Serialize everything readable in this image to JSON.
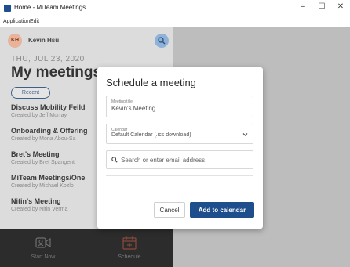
{
  "window": {
    "title": "Home - MiTeam Meetings",
    "minimize_glyph": "–",
    "maximize_glyph": "☐",
    "close_glyph": "✕"
  },
  "menubar": {
    "items": [
      "Application",
      "Edit"
    ]
  },
  "sidebar": {
    "user": {
      "initials": "KH",
      "name": "Kevin Hsu"
    },
    "date": "THU, JUL 23, 2020",
    "title": "My meetings",
    "filter": "Recent",
    "meetings": [
      {
        "title": "Discuss Mobility Feild",
        "creator": "Created by Jeff Murray"
      },
      {
        "title": "Onboarding & Offering",
        "creator": "Created by Mona Abou-Sa"
      },
      {
        "title": "Bret's Meeting",
        "creator": "Created by Bret Spangent"
      },
      {
        "title": "MiTeam Meetings/One",
        "creator": "Created by Michael Kozlo"
      },
      {
        "title": "Nitin's Meeting",
        "creator": "Created by Nitin Verma"
      }
    ],
    "bottom": {
      "start_label": "Start Now",
      "schedule_label": "Schedule"
    }
  },
  "modal": {
    "title": "Schedule a meeting",
    "meeting_title_label": "Meeting title",
    "meeting_title_value": "Kevin's Meeting",
    "calendar_label": "Calendar",
    "calendar_value": "Default Calendar (.ics download)",
    "search_placeholder": "Search or enter email address",
    "cancel_label": "Cancel",
    "add_label": "Add to calendar"
  },
  "colors": {
    "accent": "#1f4e8c",
    "sidebar_bg": "#dcdcdc",
    "bottom_bar": "#2c2c2c",
    "avatar": "#e9b39a"
  },
  "icons": {
    "search": "search-icon",
    "chevron": "chevron-down-icon",
    "start": "video-camera-icon",
    "schedule": "calendar-add-icon"
  }
}
